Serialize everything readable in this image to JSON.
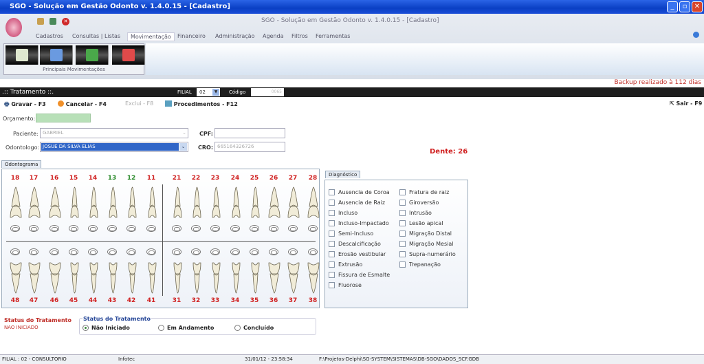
{
  "window": {
    "title": "SGO - Solução em Gestão Odonto  v. 1.4.0.15 - [Cadastro]",
    "app_title": "SGO -  Solução em Gestão Odonto  v. 1.4.0.15 - [Cadastro]"
  },
  "menu": [
    "Cadastros",
    "Consultas | Listas",
    "Movimentação",
    "Financeiro",
    "Administração",
    "Agenda",
    "Filtros",
    "Ferramentas"
  ],
  "ribbon": {
    "group_label": "Principais Movimentações"
  },
  "backup_text": "Backup realizado à 112 dias",
  "header": {
    "title": ".:: Tratamento ::.",
    "filial_label": "FILIAL",
    "filial_value": "02",
    "codigo_label": "Código",
    "codigo_value": "0065"
  },
  "toolbar": {
    "gravar": "Gravar - F3",
    "cancelar": "Cancelar - F4",
    "excluir": "Exclui - F8",
    "procedimentos": "Procedimentos - F12",
    "sair": "Sair - F9"
  },
  "form": {
    "orcamento_label": "Orçamento:",
    "orcamento_value": "",
    "paciente_label": "Paciente:",
    "paciente_value": "GABRIEL",
    "odontologo_label": "Odontologo:",
    "odontologo_value": "JOSUE DA SILVA ELIAS",
    "cpf_label": "CPF:",
    "cpf_value": "",
    "cro_label": "CRO:",
    "cro_value": "665164326726"
  },
  "dente": "Dente: 26",
  "odontograma": {
    "tab": "Odontograma",
    "upper": [
      "18",
      "17",
      "16",
      "15",
      "14",
      "13",
      "12",
      "11",
      "21",
      "22",
      "23",
      "24",
      "25",
      "26",
      "27",
      "28"
    ],
    "lower": [
      "48",
      "47",
      "46",
      "45",
      "44",
      "43",
      "42",
      "41",
      "31",
      "32",
      "33",
      "34",
      "35",
      "36",
      "37",
      "38"
    ],
    "green_teeth": [
      "13",
      "12"
    ]
  },
  "diagnostico": {
    "tab": "Diagnóstico",
    "col1": [
      "Ausencia de Coroa",
      "Ausencia de Raiz",
      "Incluso",
      "Incluso-Impactado",
      "Semi-Incluso",
      "Descalcificação",
      "Erosão vestibular",
      "Extrusão",
      "Fissura de Esmalte",
      "Fluorose"
    ],
    "col2": [
      "Fratura de raiz",
      "Giroversão",
      "Intrusão",
      "Lesão apical",
      "Migração Distal",
      "Migração Mesial",
      "Supra-numerário",
      "Trepanação"
    ]
  },
  "status": {
    "label": "Status do Tratamento",
    "value": "NAO INICIADO",
    "group_label": "Status do Tratamento",
    "options": [
      "Não Iniciado",
      "Em Andamento",
      "Concluído"
    ],
    "selected": "Não Iniciado"
  },
  "statusbar": {
    "filial": "FILIAL : 02 - CONSULTORIO",
    "user": "Infotec",
    "datetime": "31/01/12 - 23:58:34",
    "path": "F:\\Projetos-Delphi\\SG-SYSTEM\\SISTEMAS\\DB-SGO\\DADOS_SCF.GDB"
  }
}
